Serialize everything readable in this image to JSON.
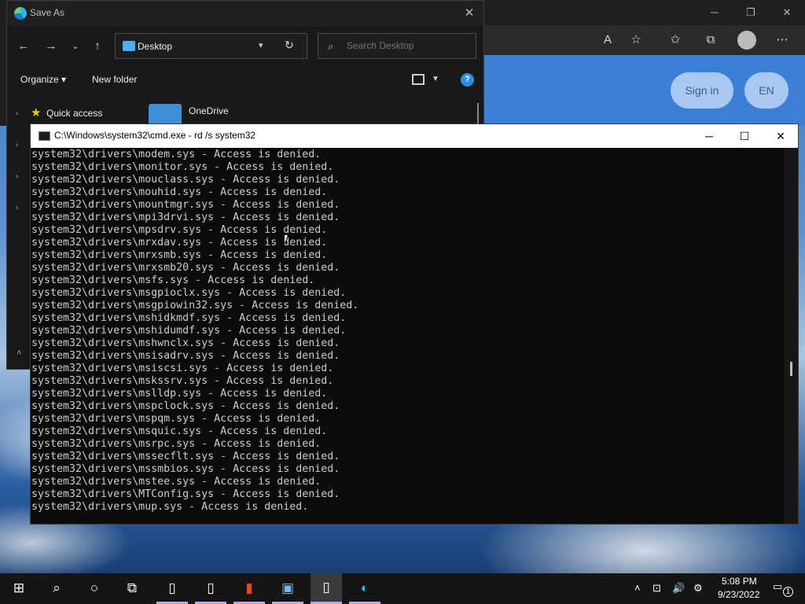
{
  "edge": {
    "toolbar_icons": [
      "read-aloud-icon",
      "add-favorite-icon",
      "favorites-icon",
      "collections-icon",
      "profile-icon",
      "more-icon"
    ],
    "sign_in_label": "Sign in",
    "language_label": "EN"
  },
  "save_as": {
    "title": "Save As",
    "address": "Desktop",
    "search_placeholder": "Search Desktop",
    "organize_label": "Organize ▾",
    "new_folder_label": "New folder",
    "quick_access_label": "Quick access",
    "onedrive_label": "OneDrive"
  },
  "cmd": {
    "title": "C:\\Windows\\system32\\cmd.exe - rd  /s system32",
    "lines": [
      "system32\\drivers\\modem.sys - Access is denied.",
      "system32\\drivers\\monitor.sys - Access is denied.",
      "system32\\drivers\\mouclass.sys - Access is denied.",
      "system32\\drivers\\mouhid.sys - Access is denied.",
      "system32\\drivers\\mountmgr.sys - Access is denied.",
      "system32\\drivers\\mpi3drvi.sys - Access is denied.",
      "system32\\drivers\\mpsdrv.sys - Access is denied.",
      "system32\\drivers\\mrxdav.sys - Access is denied.",
      "system32\\drivers\\mrxsmb.sys - Access is denied.",
      "system32\\drivers\\mrxsmb20.sys - Access is denied.",
      "system32\\drivers\\msfs.sys - Access is denied.",
      "system32\\drivers\\msgpioclx.sys - Access is denied.",
      "system32\\drivers\\msgpiowin32.sys - Access is denied.",
      "system32\\drivers\\mshidkmdf.sys - Access is denied.",
      "system32\\drivers\\mshidumdf.sys - Access is denied.",
      "system32\\drivers\\mshwnclx.sys - Access is denied.",
      "system32\\drivers\\msisadrv.sys - Access is denied.",
      "system32\\drivers\\msiscsi.sys - Access is denied.",
      "system32\\drivers\\mskssrv.sys - Access is denied.",
      "system32\\drivers\\mslldp.sys - Access is denied.",
      "system32\\drivers\\mspclock.sys - Access is denied.",
      "system32\\drivers\\mspqm.sys - Access is denied.",
      "system32\\drivers\\msquic.sys - Access is denied.",
      "system32\\drivers\\msrpc.sys - Access is denied.",
      "system32\\drivers\\mssecflt.sys - Access is denied.",
      "system32\\drivers\\mssmbios.sys - Access is denied.",
      "system32\\drivers\\mstee.sys - Access is denied.",
      "system32\\drivers\\MTConfig.sys - Access is denied.",
      "system32\\drivers\\mup.sys - Access is denied."
    ]
  },
  "taskbar": {
    "apps": [
      "start-icon",
      "search-icon",
      "cortana-icon",
      "task-view-icon",
      "file-icon",
      "file-icon",
      "office-icon",
      "photos-icon",
      "file-icon",
      "edge-icon"
    ],
    "time": "5:08 PM",
    "date": "9/23/2022",
    "notification_count": "1"
  },
  "colors": {
    "accent": "#2f8ee6",
    "console_text": "#cccccc",
    "console_bg": "#0c0c0c"
  }
}
